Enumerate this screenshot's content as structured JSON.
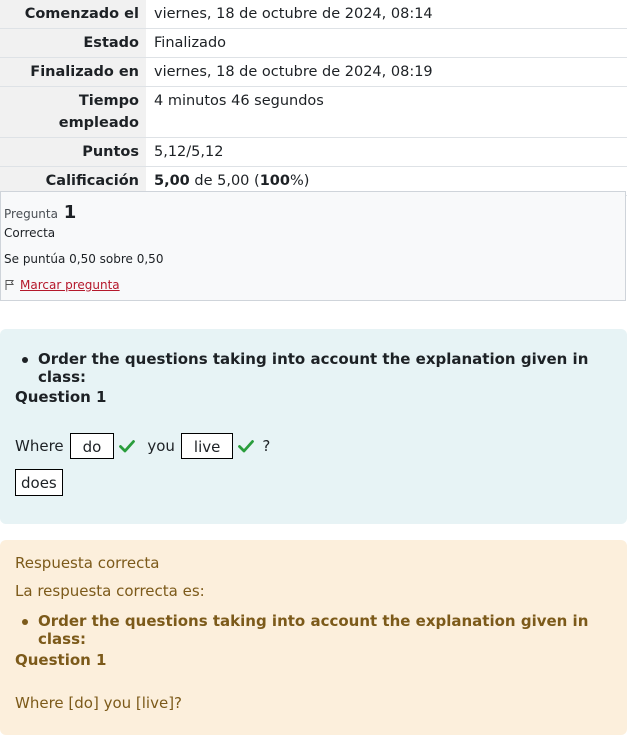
{
  "summary": {
    "rows": [
      {
        "label": "Comenzado el",
        "value": "viernes, 18 de octubre de 2024, 08:14"
      },
      {
        "label": "Estado",
        "value": "Finalizado"
      },
      {
        "label": "Finalizado en",
        "value": "viernes, 18 de octubre de 2024, 08:19"
      },
      {
        "label": "Tiempo empleado",
        "value": "4 minutos 46 segundos"
      },
      {
        "label": "Puntos",
        "value": "5,12/5,12"
      }
    ],
    "grade": {
      "label": "Calificación",
      "score": "5,00",
      "mid": " de 5,00 (",
      "percent": "100",
      "end": "%)"
    }
  },
  "question_info": {
    "prefix": "Pregunta",
    "number": "1",
    "state": "Correcta",
    "grade": "Se puntúa 0,50 sobre 0,50",
    "flag_label": "Marcar pregunta"
  },
  "formulation": {
    "instruction": "Order the questions taking into account the explanation given in class:",
    "heading": "Question 1",
    "word1": "Where",
    "drop1": "do",
    "word2": "you",
    "drop2": "live",
    "word3": "?",
    "drag_item": "does",
    "colors": {
      "background": "#e7f3f5",
      "check": "#2a9d3c"
    }
  },
  "feedback": {
    "result": "Respuesta correcta",
    "correct_intro": "La respuesta correcta es:",
    "instruction": "Order the questions taking into account the explanation given in class:",
    "heading": "Question 1",
    "answer": "Where [do] you [live]?",
    "colors": {
      "background": "#fcefdc",
      "text": "#7c5a1a"
    }
  }
}
